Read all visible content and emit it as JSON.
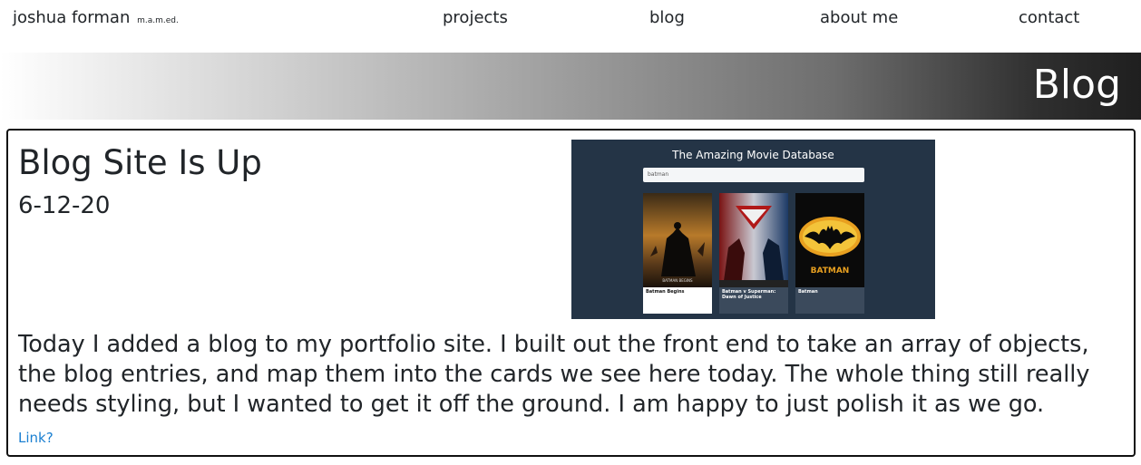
{
  "nav": {
    "brand_name": "joshua forman",
    "brand_suffix": "m.a.m.ed.",
    "links": [
      "projects",
      "blog",
      "about me",
      "contact"
    ]
  },
  "banner": {
    "title": "Blog"
  },
  "post": {
    "title": "Blog Site Is Up",
    "date": "6-12-20",
    "body": "Today I added a blog to my portfolio site. I built out the front end to take an array of objects, the blog entries, and map them into the cards we see here today. The whole thing still really needs styling, but I wanted to get it off the ground. I am happy to just polish it as we go.",
    "link_text": "Link?",
    "image": {
      "heading": "The Amazing Movie Database",
      "search_value": "batman",
      "movies": [
        {
          "title": "Batman Begins",
          "poster_text": "BATMAN BEGINS"
        },
        {
          "title": "Batman v Superman: Dawn of Justice",
          "poster_text": ""
        },
        {
          "title": "Batman",
          "poster_text": "BATMAN"
        }
      ]
    }
  },
  "colors": {
    "link": "#1a7fd1",
    "thumbnail_bg": "#243446",
    "card_border": "#111111"
  }
}
